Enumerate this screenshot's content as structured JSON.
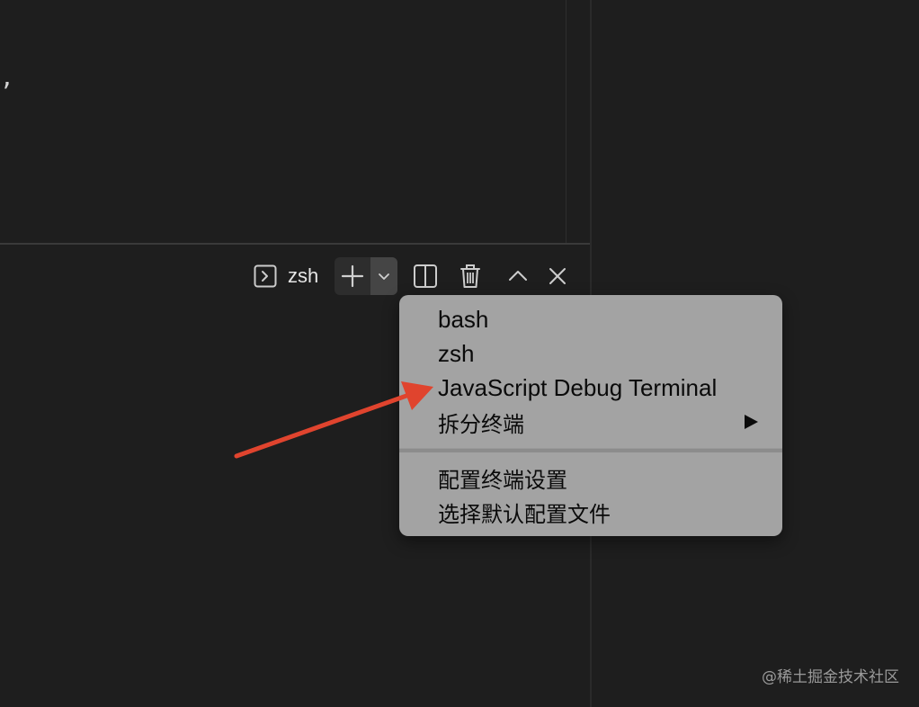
{
  "editor": {
    "visible_text": ","
  },
  "terminal_toolbar": {
    "active_terminal_name": "zsh",
    "icons": {
      "terminal": "terminal-prompt-icon",
      "new_terminal": "plus-icon",
      "launch_profile": "chevron-down-icon",
      "split": "split-terminal-icon",
      "kill": "trash-icon",
      "maximize": "chevron-up-icon",
      "close": "close-icon"
    }
  },
  "profile_menu": {
    "items": [
      {
        "label": "bash"
      },
      {
        "label": "zsh"
      },
      {
        "label": "JavaScript Debug Terminal"
      },
      {
        "label": "拆分终端",
        "has_submenu": true,
        "submenu_icon": "triangle-right-icon"
      }
    ],
    "items_after_separator": [
      {
        "label": "配置终端设置"
      },
      {
        "label": "选择默认配置文件"
      }
    ]
  },
  "annotation": {
    "color": "#e0442e",
    "points_to": "JavaScript Debug Terminal"
  },
  "watermark": {
    "text": "@稀土掘金技术社区"
  },
  "colors": {
    "background": "#1e1e1e",
    "menu_background": "#a3a3a3",
    "toolbar_icon": "#cccccc"
  }
}
